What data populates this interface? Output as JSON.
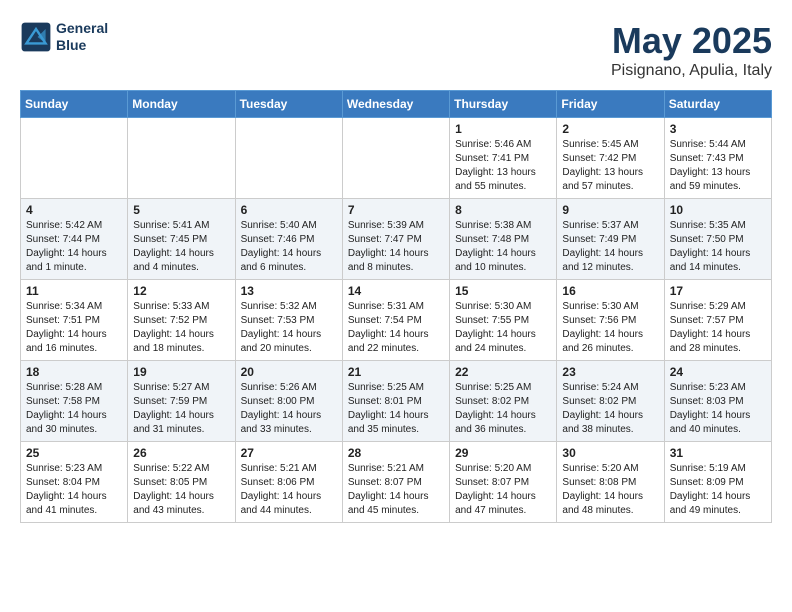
{
  "header": {
    "logo_line1": "General",
    "logo_line2": "Blue",
    "month_title": "May 2025",
    "location": "Pisignano, Apulia, Italy"
  },
  "weekdays": [
    "Sunday",
    "Monday",
    "Tuesday",
    "Wednesday",
    "Thursday",
    "Friday",
    "Saturday"
  ],
  "weeks": [
    [
      {
        "day": "",
        "sunrise": "",
        "sunset": "",
        "daylight": "",
        "empty": true
      },
      {
        "day": "",
        "sunrise": "",
        "sunset": "",
        "daylight": "",
        "empty": true
      },
      {
        "day": "",
        "sunrise": "",
        "sunset": "",
        "daylight": "",
        "empty": true
      },
      {
        "day": "",
        "sunrise": "",
        "sunset": "",
        "daylight": "",
        "empty": true
      },
      {
        "day": "1",
        "sunrise": "Sunrise: 5:46 AM",
        "sunset": "Sunset: 7:41 PM",
        "daylight": "Daylight: 13 hours and 55 minutes."
      },
      {
        "day": "2",
        "sunrise": "Sunrise: 5:45 AM",
        "sunset": "Sunset: 7:42 PM",
        "daylight": "Daylight: 13 hours and 57 minutes."
      },
      {
        "day": "3",
        "sunrise": "Sunrise: 5:44 AM",
        "sunset": "Sunset: 7:43 PM",
        "daylight": "Daylight: 13 hours and 59 minutes."
      }
    ],
    [
      {
        "day": "4",
        "sunrise": "Sunrise: 5:42 AM",
        "sunset": "Sunset: 7:44 PM",
        "daylight": "Daylight: 14 hours and 1 minute."
      },
      {
        "day": "5",
        "sunrise": "Sunrise: 5:41 AM",
        "sunset": "Sunset: 7:45 PM",
        "daylight": "Daylight: 14 hours and 4 minutes."
      },
      {
        "day": "6",
        "sunrise": "Sunrise: 5:40 AM",
        "sunset": "Sunset: 7:46 PM",
        "daylight": "Daylight: 14 hours and 6 minutes."
      },
      {
        "day": "7",
        "sunrise": "Sunrise: 5:39 AM",
        "sunset": "Sunset: 7:47 PM",
        "daylight": "Daylight: 14 hours and 8 minutes."
      },
      {
        "day": "8",
        "sunrise": "Sunrise: 5:38 AM",
        "sunset": "Sunset: 7:48 PM",
        "daylight": "Daylight: 14 hours and 10 minutes."
      },
      {
        "day": "9",
        "sunrise": "Sunrise: 5:37 AM",
        "sunset": "Sunset: 7:49 PM",
        "daylight": "Daylight: 14 hours and 12 minutes."
      },
      {
        "day": "10",
        "sunrise": "Sunrise: 5:35 AM",
        "sunset": "Sunset: 7:50 PM",
        "daylight": "Daylight: 14 hours and 14 minutes."
      }
    ],
    [
      {
        "day": "11",
        "sunrise": "Sunrise: 5:34 AM",
        "sunset": "Sunset: 7:51 PM",
        "daylight": "Daylight: 14 hours and 16 minutes."
      },
      {
        "day": "12",
        "sunrise": "Sunrise: 5:33 AM",
        "sunset": "Sunset: 7:52 PM",
        "daylight": "Daylight: 14 hours and 18 minutes."
      },
      {
        "day": "13",
        "sunrise": "Sunrise: 5:32 AM",
        "sunset": "Sunset: 7:53 PM",
        "daylight": "Daylight: 14 hours and 20 minutes."
      },
      {
        "day": "14",
        "sunrise": "Sunrise: 5:31 AM",
        "sunset": "Sunset: 7:54 PM",
        "daylight": "Daylight: 14 hours and 22 minutes."
      },
      {
        "day": "15",
        "sunrise": "Sunrise: 5:30 AM",
        "sunset": "Sunset: 7:55 PM",
        "daylight": "Daylight: 14 hours and 24 minutes."
      },
      {
        "day": "16",
        "sunrise": "Sunrise: 5:30 AM",
        "sunset": "Sunset: 7:56 PM",
        "daylight": "Daylight: 14 hours and 26 minutes."
      },
      {
        "day": "17",
        "sunrise": "Sunrise: 5:29 AM",
        "sunset": "Sunset: 7:57 PM",
        "daylight": "Daylight: 14 hours and 28 minutes."
      }
    ],
    [
      {
        "day": "18",
        "sunrise": "Sunrise: 5:28 AM",
        "sunset": "Sunset: 7:58 PM",
        "daylight": "Daylight: 14 hours and 30 minutes."
      },
      {
        "day": "19",
        "sunrise": "Sunrise: 5:27 AM",
        "sunset": "Sunset: 7:59 PM",
        "daylight": "Daylight: 14 hours and 31 minutes."
      },
      {
        "day": "20",
        "sunrise": "Sunrise: 5:26 AM",
        "sunset": "Sunset: 8:00 PM",
        "daylight": "Daylight: 14 hours and 33 minutes."
      },
      {
        "day": "21",
        "sunrise": "Sunrise: 5:25 AM",
        "sunset": "Sunset: 8:01 PM",
        "daylight": "Daylight: 14 hours and 35 minutes."
      },
      {
        "day": "22",
        "sunrise": "Sunrise: 5:25 AM",
        "sunset": "Sunset: 8:02 PM",
        "daylight": "Daylight: 14 hours and 36 minutes."
      },
      {
        "day": "23",
        "sunrise": "Sunrise: 5:24 AM",
        "sunset": "Sunset: 8:02 PM",
        "daylight": "Daylight: 14 hours and 38 minutes."
      },
      {
        "day": "24",
        "sunrise": "Sunrise: 5:23 AM",
        "sunset": "Sunset: 8:03 PM",
        "daylight": "Daylight: 14 hours and 40 minutes."
      }
    ],
    [
      {
        "day": "25",
        "sunrise": "Sunrise: 5:23 AM",
        "sunset": "Sunset: 8:04 PM",
        "daylight": "Daylight: 14 hours and 41 minutes."
      },
      {
        "day": "26",
        "sunrise": "Sunrise: 5:22 AM",
        "sunset": "Sunset: 8:05 PM",
        "daylight": "Daylight: 14 hours and 43 minutes."
      },
      {
        "day": "27",
        "sunrise": "Sunrise: 5:21 AM",
        "sunset": "Sunset: 8:06 PM",
        "daylight": "Daylight: 14 hours and 44 minutes."
      },
      {
        "day": "28",
        "sunrise": "Sunrise: 5:21 AM",
        "sunset": "Sunset: 8:07 PM",
        "daylight": "Daylight: 14 hours and 45 minutes."
      },
      {
        "day": "29",
        "sunrise": "Sunrise: 5:20 AM",
        "sunset": "Sunset: 8:07 PM",
        "daylight": "Daylight: 14 hours and 47 minutes."
      },
      {
        "day": "30",
        "sunrise": "Sunrise: 5:20 AM",
        "sunset": "Sunset: 8:08 PM",
        "daylight": "Daylight: 14 hours and 48 minutes."
      },
      {
        "day": "31",
        "sunrise": "Sunrise: 5:19 AM",
        "sunset": "Sunset: 8:09 PM",
        "daylight": "Daylight: 14 hours and 49 minutes."
      }
    ]
  ]
}
